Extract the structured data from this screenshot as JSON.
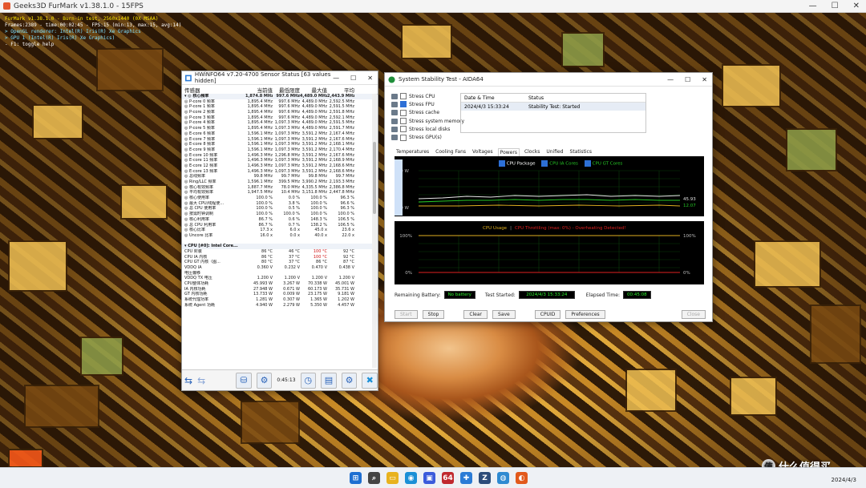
{
  "furmark": {
    "title": "Geeks3D FurMark v1.38.1.0 - 15FPS",
    "overlay": [
      {
        "text": "FurMark v1.38.1.0 - Burn-in test, 2560x1440 (0X MSAA)",
        "color": "y"
      },
      {
        "text": "Frames:2389 - time:00:02:45 - FPS:15 (min:13, max:15, avg:14)",
        "color": "w"
      },
      {
        "text": "> OpenGL renderer: Intel(R) Iris(R) Xe Graphics",
        "color": "c"
      },
      {
        "text": "> GPU 1 (Intel(R) Iris(R) Xe Graphics)",
        "color": "c"
      },
      {
        "text": "- F1: toggle help",
        "color": "w"
      }
    ]
  },
  "hwinfo": {
    "title": "HWiNFO64 v7.20-4700 Sensor Status [63 values hidden]",
    "headers": [
      "传感器",
      "当前值",
      "最低限度",
      "最大值",
      "平均"
    ],
    "rows": [
      {
        "n": "▾ ◎ 核心频率",
        "v": [
          "1,874.8 MHz",
          "997.6 MHz",
          "4,489.0 MHz",
          "2,443.9 MHz"
        ],
        "sec": true
      },
      {
        "n": "   ◎ P-core 0 频率",
        "v": [
          "1,895.4 MHz",
          "997.6 MHz",
          "4,489.0 MHz",
          "2,592.5 MHz"
        ]
      },
      {
        "n": "   ◎ P-core 1 频率",
        "v": [
          "1,895.4 MHz",
          "997.6 MHz",
          "4,489.0 MHz",
          "2,591.5 MHz"
        ]
      },
      {
        "n": "   ◎ P-core 2 频率",
        "v": [
          "1,895.4 MHz",
          "997.6 MHz",
          "4,489.0 MHz",
          "2,591.8 MHz"
        ]
      },
      {
        "n": "   ◎ P-core 3 频率",
        "v": [
          "1,895.4 MHz",
          "997.6 MHz",
          "4,489.0 MHz",
          "2,592.1 MHz"
        ]
      },
      {
        "n": "   ◎ P-core 4 频率",
        "v": [
          "1,895.4 MHz",
          "1,097.3 MHz",
          "4,489.0 MHz",
          "2,591.5 MHz"
        ]
      },
      {
        "n": "   ◎ P-core 5 频率",
        "v": [
          "1,895.4 MHz",
          "1,097.3 MHz",
          "4,489.0 MHz",
          "2,591.7 MHz"
        ]
      },
      {
        "n": "   ◎ E-core 6 频率",
        "v": [
          "1,596.1 MHz",
          "1,097.3 MHz",
          "3,591.2 MHz",
          "2,167.4 MHz"
        ]
      },
      {
        "n": "   ◎ E-core 7 频率",
        "v": [
          "1,596.1 MHz",
          "1,097.3 MHz",
          "3,591.2 MHz",
          "2,167.6 MHz"
        ]
      },
      {
        "n": "   ◎ E-core 8 频率",
        "v": [
          "1,596.1 MHz",
          "1,097.3 MHz",
          "3,591.2 MHz",
          "2,168.1 MHz"
        ]
      },
      {
        "n": "   ◎ E-core 9 频率",
        "v": [
          "1,596.1 MHz",
          "1,097.3 MHz",
          "3,591.2 MHz",
          "2,170.4 MHz"
        ]
      },
      {
        "n": "   ◎ E-core 10 频率",
        "v": [
          "1,496.3 MHz",
          "1,296.8 MHz",
          "3,591.2 MHz",
          "2,167.6 MHz"
        ]
      },
      {
        "n": "   ◎ E-core 11 频率",
        "v": [
          "1,496.3 MHz",
          "1,097.3 MHz",
          "3,591.2 MHz",
          "2,168.9 MHz"
        ]
      },
      {
        "n": "   ◎ E-core 12 频率",
        "v": [
          "1,496.3 MHz",
          "1,097.3 MHz",
          "3,591.2 MHz",
          "2,168.6 MHz"
        ]
      },
      {
        "n": "   ◎ E-core 13 频率",
        "v": [
          "1,496.3 MHz",
          "1,097.3 MHz",
          "3,591.2 MHz",
          "2,168.6 MHz"
        ]
      },
      {
        "n": "◎ 总线频率",
        "v": [
          "99.8 MHz",
          "99.7 MHz",
          "99.8 MHz",
          "99.7 MHz"
        ]
      },
      {
        "n": "◎ Ring/LLC 频率",
        "v": [
          "1,596.1 MHz",
          "399.5 MHz",
          "3,990.2 MHz",
          "2,193.3 MHz"
        ]
      },
      {
        "n": "◎ 核心有效频率",
        "v": [
          "1,887.7 MHz",
          "78.0 MHz",
          "4,335.5 MHz",
          "2,386.8 MHz"
        ]
      },
      {
        "n": "◎ 平均有效频率",
        "v": [
          "1,947.5 MHz",
          "10.4 MHz",
          "3,151.8 MHz",
          "2,447.8 MHz"
        ]
      },
      {
        "n": "◎ 核心使用率",
        "v": [
          "100.0 %",
          "0.0 %",
          "100.0 %",
          "96.3 %"
        ]
      },
      {
        "n": "◎ 最大 CPU/线程使...",
        "v": [
          "100.0 %",
          "3.8 %",
          "100.0 %",
          "96.6 %"
        ]
      },
      {
        "n": "◎ 总 CPU 使用率",
        "v": [
          "100.0 %",
          "0.5 %",
          "100.0 %",
          "96.3 %"
        ]
      },
      {
        "n": "◎ 按需时钟调制",
        "v": [
          "100.0 %",
          "100.0 %",
          "100.0 %",
          "100.0 %"
        ]
      },
      {
        "n": "◎ 核心利用率",
        "v": [
          "86.7 %",
          "0.6 %",
          "148.3 %",
          "106.5 %"
        ]
      },
      {
        "n": "◎ 总 CPU 利用率",
        "v": [
          "86.7 %",
          "0.7 %",
          "138.2 %",
          "106.5 %"
        ]
      },
      {
        "n": "◎ 核心比率",
        "v": [
          "17.3 x",
          "6.0 x",
          "45.0 x",
          "23.6 x"
        ]
      },
      {
        "n": "◎ Uncore 比率",
        "v": [
          "16.0 x",
          "0.0 x",
          "40.0 x",
          "22.0 x"
        ]
      },
      {
        "n": "",
        "v": [
          "",
          "",
          "",
          ""
        ]
      },
      {
        "n": "▾ CPU [#0]: Intel Core...",
        "v": [
          "",
          "",
          "",
          ""
        ],
        "sec": true
      },
      {
        "n": "  CPU 封装",
        "v": [
          "86 °C",
          "46 °C",
          "100 °C",
          "92 °C"
        ],
        "hot": true
      },
      {
        "n": "  CPU IA 内核",
        "v": [
          "86 °C",
          "37 °C",
          "100 °C",
          "92 °C"
        ],
        "hot": true
      },
      {
        "n": "  CPU GT 内核（图...",
        "v": [
          "80 °C",
          "37 °C",
          "86 °C",
          "87 °C"
        ]
      },
      {
        "n": "  VDDQ IA",
        "v": [
          "0.360 V",
          "0.232 V",
          "0.470 V",
          "0.438 V"
        ]
      },
      {
        "n": "  电压偏移",
        "v": [
          "",
          "",
          "",
          ""
        ]
      },
      {
        "n": "  VDDQ TX 电压",
        "v": [
          "1.200 V",
          "1.200 V",
          "1.200 V",
          "1.200 V"
        ]
      },
      {
        "n": "  CPU整体功耗",
        "v": [
          "45.993 W",
          "3.267 W",
          "70.338 W",
          "45.001 W"
        ]
      },
      {
        "n": "  IA 内核功耗",
        "v": [
          "27.948 W",
          "0.671 W",
          "60.173 W",
          "35.731 W"
        ]
      },
      {
        "n": "  GT 内核功耗",
        "v": [
          "13.733 W",
          "0.009 W",
          "23.175 W",
          "9.181 W"
        ]
      },
      {
        "n": "  系统代理功率",
        "v": [
          "1.281 W",
          "0.307 W",
          "1.365 W",
          "1.202 W"
        ]
      },
      {
        "n": "  系统 Agent 功耗",
        "v": [
          "4.940 W",
          "2.279 W",
          "5.350 W",
          "4.457 W"
        ]
      }
    ],
    "time": "0:45:13"
  },
  "aida": {
    "title": "System Stability Test - AIDA64",
    "stress": [
      {
        "label": "Stress CPU",
        "on": false
      },
      {
        "label": "Stress FPU",
        "on": true
      },
      {
        "label": "Stress cache",
        "on": false
      },
      {
        "label": "Stress system memory",
        "on": false
      },
      {
        "label": "Stress local disks",
        "on": false
      },
      {
        "label": "Stress GPU(s)",
        "on": false
      }
    ],
    "status_headers": {
      "date": "Date & Time",
      "status": "Status"
    },
    "status_row": {
      "date": "2024/4/3 15:33:24",
      "status": "Stability Test: Started"
    },
    "tabs": [
      "Temperatures",
      "Cooling Fans",
      "Voltages",
      "Powers",
      "Clocks",
      "Unified",
      "Statistics"
    ],
    "active_tab": "Powers",
    "legend1": [
      "CPU Package",
      "CPU IA Cores",
      "CPU GT Cores"
    ],
    "g1_ymax": "200 W",
    "g1_ymin": "0 W",
    "g1_val1": "45.93",
    "g1_val2": "12.07",
    "legend2_a": "CPU Usage",
    "legend2_b": "CPU Throttling (max: 0%) - Overheating Detected!",
    "g2_ymax": "100%",
    "g2_ymin": "0%",
    "g2_rmax": "100%",
    "g2_rmin": "0%",
    "battery_label": "Remaining Battery:",
    "battery_val": "No battery",
    "started_label": "Test Started:",
    "started_val": "2024/4/3 15:33:24",
    "elapsed_label": "Elapsed Time:",
    "elapsed_val": "00:45:08",
    "buttons": {
      "start": "Start",
      "stop": "Stop",
      "clear": "Clear",
      "save": "Save",
      "cpuid": "CPUID",
      "prefs": "Preferences",
      "close": "Close"
    }
  },
  "taskbar": {
    "date": "2024/4/3",
    "apps": [
      {
        "name": "windows-start-icon",
        "glyph": "⊞",
        "color": "#1f6fd1"
      },
      {
        "name": "search-icon",
        "glyph": "⌕",
        "color": "#444"
      },
      {
        "name": "file-explorer-icon",
        "glyph": "▭",
        "color": "#e8b21e"
      },
      {
        "name": "edge-icon",
        "glyph": "◉",
        "color": "#1b8fd6"
      },
      {
        "name": "store-icon",
        "glyph": "▣",
        "color": "#3b5bdb"
      },
      {
        "name": "aida64-icon",
        "glyph": "64",
        "color": "#c0292f"
      },
      {
        "name": "hwinfo-icon",
        "glyph": "✚",
        "color": "#2b7bd6"
      },
      {
        "name": "gpuz-icon",
        "glyph": "Z",
        "color": "#2c4c7a"
      },
      {
        "name": "globe-icon",
        "glyph": "◍",
        "color": "#2f8ad1"
      },
      {
        "name": "furmark-icon",
        "glyph": "◐",
        "color": "#e25a1c"
      }
    ]
  },
  "watermark": {
    "logo": "值",
    "text": "什么值得买"
  }
}
